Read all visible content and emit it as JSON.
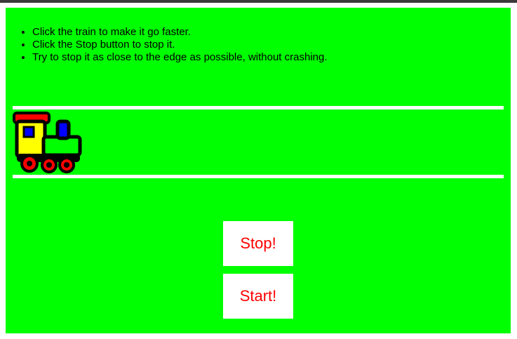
{
  "instructions": [
    "Click the train to make it go faster.",
    "Click the Stop button to stop it.",
    "Try to stop it as close to the edge as possible, without crashing."
  ],
  "buttons": {
    "stop_label": "Stop!",
    "start_label": "Start!"
  },
  "train": {
    "icon": "train-icon"
  },
  "colors": {
    "background": "#00ff00",
    "rail": "#ffffff",
    "button_text": "#ff0000",
    "button_bg": "#ffffff"
  }
}
